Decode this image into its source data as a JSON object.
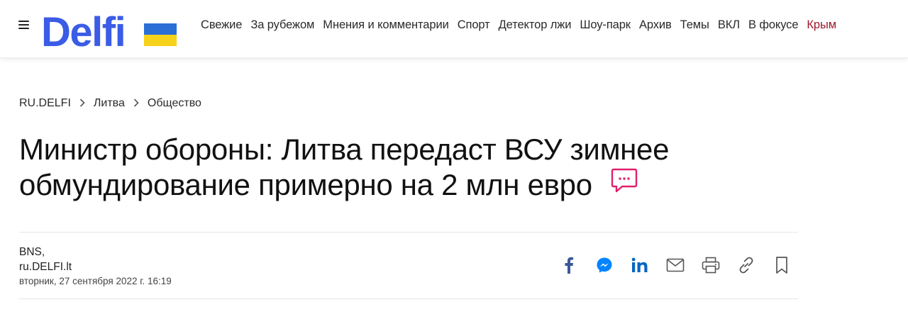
{
  "header": {
    "logo_text": "Delfi",
    "nav": [
      {
        "label": "Свежие"
      },
      {
        "label": "За рубежом"
      },
      {
        "label": "Мнения и комментарии"
      },
      {
        "label": "Спорт"
      },
      {
        "label": "Детектор лжи"
      },
      {
        "label": "Шоу-парк"
      },
      {
        "label": "Архив"
      },
      {
        "label": "Темы"
      },
      {
        "label": "ВКЛ"
      },
      {
        "label": "В фокусе"
      },
      {
        "label": "Крым"
      }
    ]
  },
  "breadcrumb": [
    "RU.DELFI",
    "Литва",
    "Общество"
  ],
  "article": {
    "title_line1": "Министр обороны: Литва передаст ВСУ зимнее",
    "title_line2": "обмундирование примерно на 2 млн евро",
    "author_line1": "BNS,",
    "author_line2": "ru.DELFI.lt",
    "date": "вторник, 27 сентября 2022 г. 16:19"
  },
  "share_icons": [
    "facebook-icon",
    "messenger-icon",
    "linkedin-icon",
    "email-icon",
    "print-icon",
    "link-icon",
    "bookmark-icon"
  ],
  "colors": {
    "logo_blue": "#3b5ce6",
    "flag_blue": "#2b6fd6",
    "flag_yellow": "#f7d21a",
    "accent_red": "#a0192b",
    "comment_pink": "#e0206e",
    "facebook": "#3b5998",
    "messenger": "#0084ff",
    "linkedin": "#0a66c2"
  }
}
